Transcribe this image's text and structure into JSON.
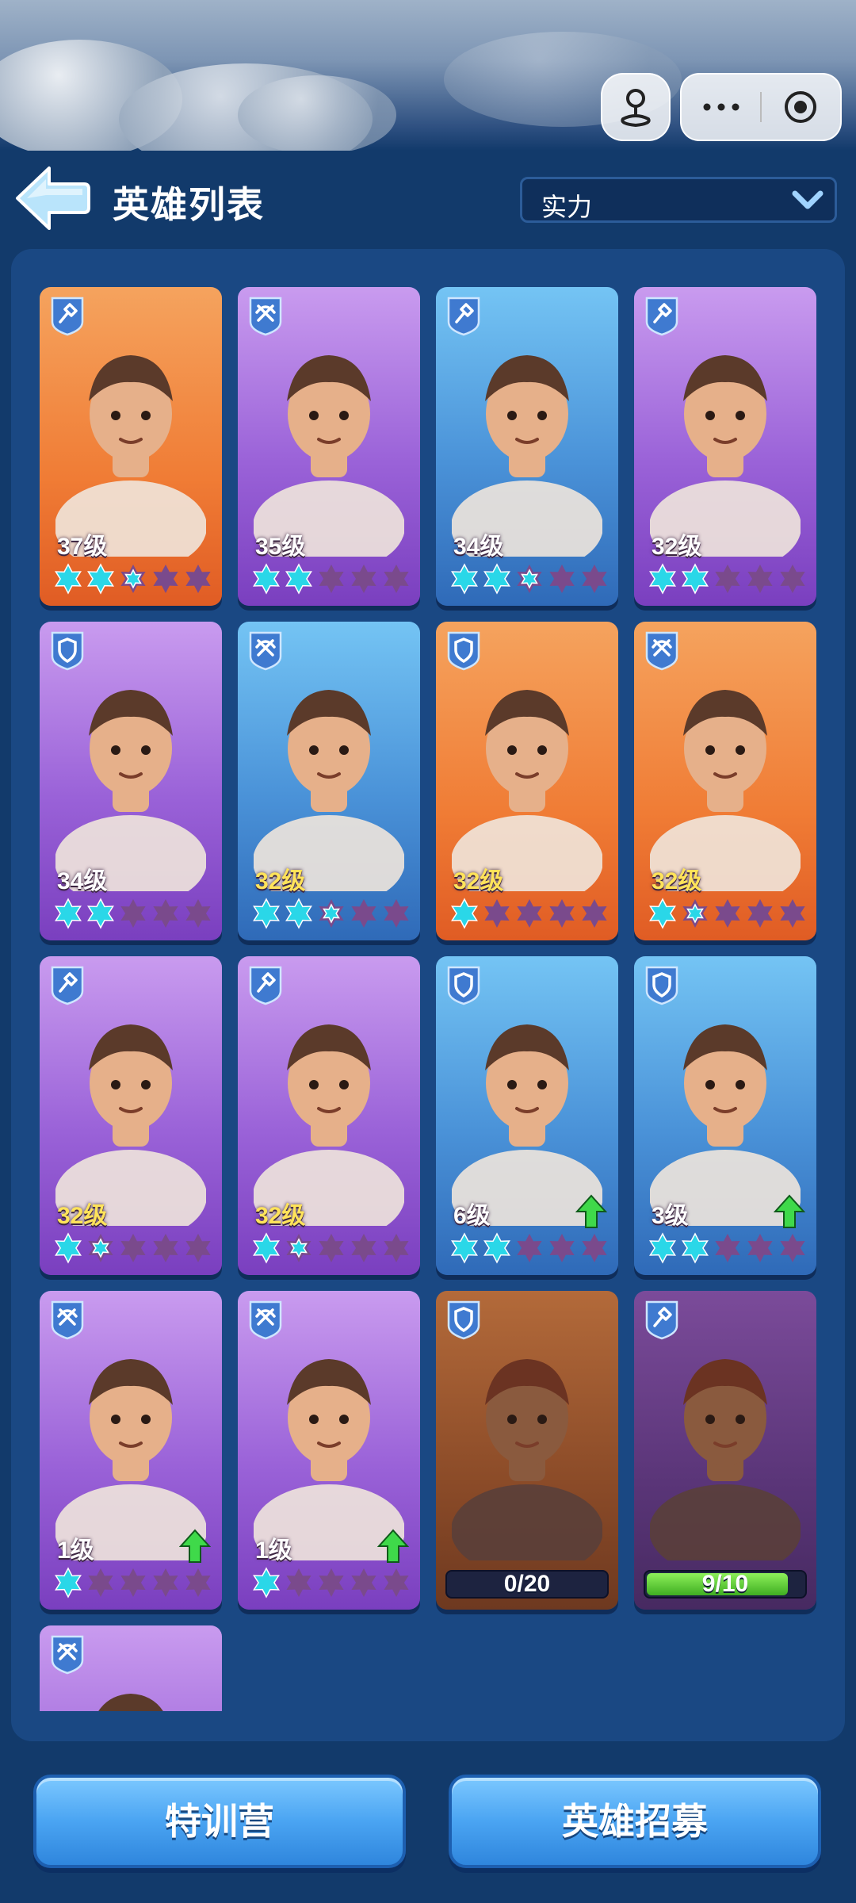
{
  "header": {
    "title": "英雄列表",
    "sort_selected": "实力",
    "back_icon": "back-arrow-icon"
  },
  "mini_program": {
    "avatar_icon": "user-icon",
    "more_icon": "more-dots-icon",
    "close_icon": "target-close-icon"
  },
  "colors": {
    "orange": "#f07c35",
    "purple": "#9a62d8",
    "blue": "#4a92d8",
    "star_on": "#2ad7e8",
    "star_off": "#7a4a8c",
    "level_gold": "#ffe35a",
    "upgrade_green": "#3fd94a"
  },
  "heroes": [
    {
      "rarity": "orange",
      "role": "shovel",
      "level": "37级",
      "level_gold": false,
      "stars": 2.5,
      "upgrade": false
    },
    {
      "rarity": "purple",
      "role": "crossbow",
      "level": "35级",
      "level_gold": false,
      "stars": 2,
      "upgrade": false
    },
    {
      "rarity": "blue",
      "role": "shovel",
      "level": "34级",
      "level_gold": false,
      "stars": 2.5,
      "upgrade": false
    },
    {
      "rarity": "purple",
      "role": "shovel",
      "level": "32级",
      "level_gold": false,
      "stars": 2,
      "upgrade": false
    },
    {
      "rarity": "purple",
      "role": "shield",
      "level": "34级",
      "level_gold": false,
      "stars": 2,
      "upgrade": false
    },
    {
      "rarity": "blue",
      "role": "crossbow",
      "level": "32级",
      "level_gold": true,
      "stars": 2.5,
      "upgrade": false
    },
    {
      "rarity": "orange",
      "role": "shield",
      "level": "32级",
      "level_gold": true,
      "stars": 1,
      "upgrade": false
    },
    {
      "rarity": "orange",
      "role": "crossbow",
      "level": "32级",
      "level_gold": true,
      "stars": 1.5,
      "upgrade": false
    },
    {
      "rarity": "purple",
      "role": "shovel",
      "level": "32级",
      "level_gold": true,
      "stars": 1.5,
      "upgrade": false
    },
    {
      "rarity": "purple",
      "role": "shovel",
      "level": "32级",
      "level_gold": true,
      "stars": 1.5,
      "upgrade": false
    },
    {
      "rarity": "blue",
      "role": "shield",
      "level": "6级",
      "level_gold": false,
      "stars": 2,
      "upgrade": true
    },
    {
      "rarity": "blue",
      "role": "shield",
      "level": "3级",
      "level_gold": false,
      "stars": 2,
      "upgrade": true
    },
    {
      "rarity": "purple",
      "role": "crossbow",
      "level": "1级",
      "level_gold": false,
      "stars": 1,
      "upgrade": true
    },
    {
      "rarity": "purple",
      "role": "crossbow",
      "level": "1级",
      "level_gold": false,
      "stars": 1,
      "upgrade": true
    },
    {
      "rarity": "locked-orange",
      "role": "shield",
      "shards": "0/20",
      "shard_progress": 0.0
    },
    {
      "rarity": "locked-purple",
      "role": "shovel",
      "shards": "9/10",
      "shard_progress": 0.9
    },
    {
      "rarity": "purple",
      "role": "crossbow",
      "partial": true
    }
  ],
  "buttons": {
    "training": "特训营",
    "recruit": "英雄招募"
  }
}
